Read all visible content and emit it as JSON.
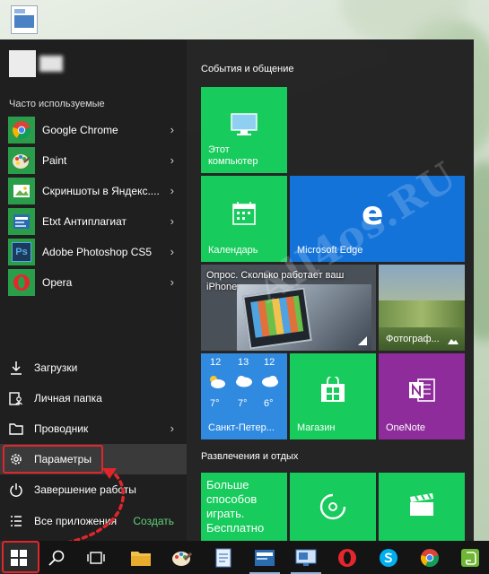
{
  "start_menu": {
    "most_used_label": "Часто используемые",
    "apps": [
      {
        "label": "Google Chrome",
        "icon": "chrome-icon",
        "icon_bg": "#2a9d4a",
        "has_chevron": true
      },
      {
        "label": "Paint",
        "icon": "paint-icon",
        "icon_bg": "#2a9d4a",
        "has_chevron": true
      },
      {
        "label": "Скриншоты в Яндекс....",
        "icon": "yandex-screenshot-icon",
        "icon_bg": "#2a9d4a",
        "has_chevron": true
      },
      {
        "label": "Etxt Антиплагиат",
        "icon": "etxt-icon",
        "icon_bg": "#2a9d4a",
        "has_chevron": true
      },
      {
        "label": "Adobe Photoshop CS5",
        "icon": "photoshop-icon",
        "icon_bg": "#2a9d4a",
        "icon_text": "Ps",
        "has_chevron": true
      },
      {
        "label": "Opera",
        "icon": "opera-icon",
        "icon_bg": "#2a9d4a",
        "icon_text": "O",
        "has_chevron": true
      }
    ],
    "system_items": [
      {
        "label": "Загрузки",
        "icon": "download-icon"
      },
      {
        "label": "Личная папка",
        "icon": "personal-folder-icon"
      },
      {
        "label": "Проводник",
        "icon": "explorer-icon",
        "has_chevron": true
      },
      {
        "label": "Параметры",
        "icon": "gear-icon"
      },
      {
        "label": "Завершение работы",
        "icon": "power-icon"
      },
      {
        "label": "Все приложения",
        "icon": "all-apps-icon"
      }
    ],
    "create_label": "Создать"
  },
  "tile_groups": [
    {
      "label": "События и общение"
    },
    {
      "label": "Развлечения и отдых"
    }
  ],
  "tiles": {
    "this_pc": {
      "label": "Этот компьютер",
      "bg": "#17cb5c"
    },
    "calendar": {
      "label": "Календарь",
      "bg": "#17cb5c"
    },
    "edge": {
      "label": "Microsoft Edge",
      "bg": "#1473d9"
    },
    "news": {
      "label": "Опрос. Сколько работает ваш iPhone"
    },
    "photos": {
      "label": "Фотограф..."
    },
    "weather": {
      "days": [
        {
          "hi": "12",
          "lo": "7°"
        },
        {
          "hi": "13",
          "lo": "7°"
        },
        {
          "hi": "12",
          "lo": "6°"
        }
      ],
      "city": "Санкт-Петер...",
      "bg": "#2f8ae0"
    },
    "store": {
      "label": "Магазин",
      "bg": "#17cb5c"
    },
    "onenote": {
      "label": "OneNote",
      "bg": "#8f2c9c"
    },
    "xbox": {
      "label": "Больше способов играть. Бесплатно",
      "bg": "#17cb5c"
    },
    "groove": {
      "bg": "#17cb5c"
    },
    "movies": {
      "bg": "#17cb5c"
    }
  },
  "watermark": "All4os.RU",
  "colors": {
    "accent_green": "#17cb5c",
    "highlight_red": "#e0262b",
    "create_green": "#5fd37a"
  },
  "taskbar": {
    "items": [
      {
        "icon": "windows-start-icon"
      },
      {
        "icon": "search-icon"
      },
      {
        "icon": "task-view-icon"
      },
      {
        "icon": "file-explorer-icon"
      },
      {
        "icon": "paint-icon"
      },
      {
        "icon": "notepad-icon"
      },
      {
        "icon": "etxt-icon"
      },
      {
        "icon": "remote-desktop-icon"
      },
      {
        "icon": "opera-icon"
      },
      {
        "icon": "skype-icon"
      },
      {
        "icon": "chrome-icon"
      },
      {
        "icon": "evernote-icon"
      }
    ]
  }
}
